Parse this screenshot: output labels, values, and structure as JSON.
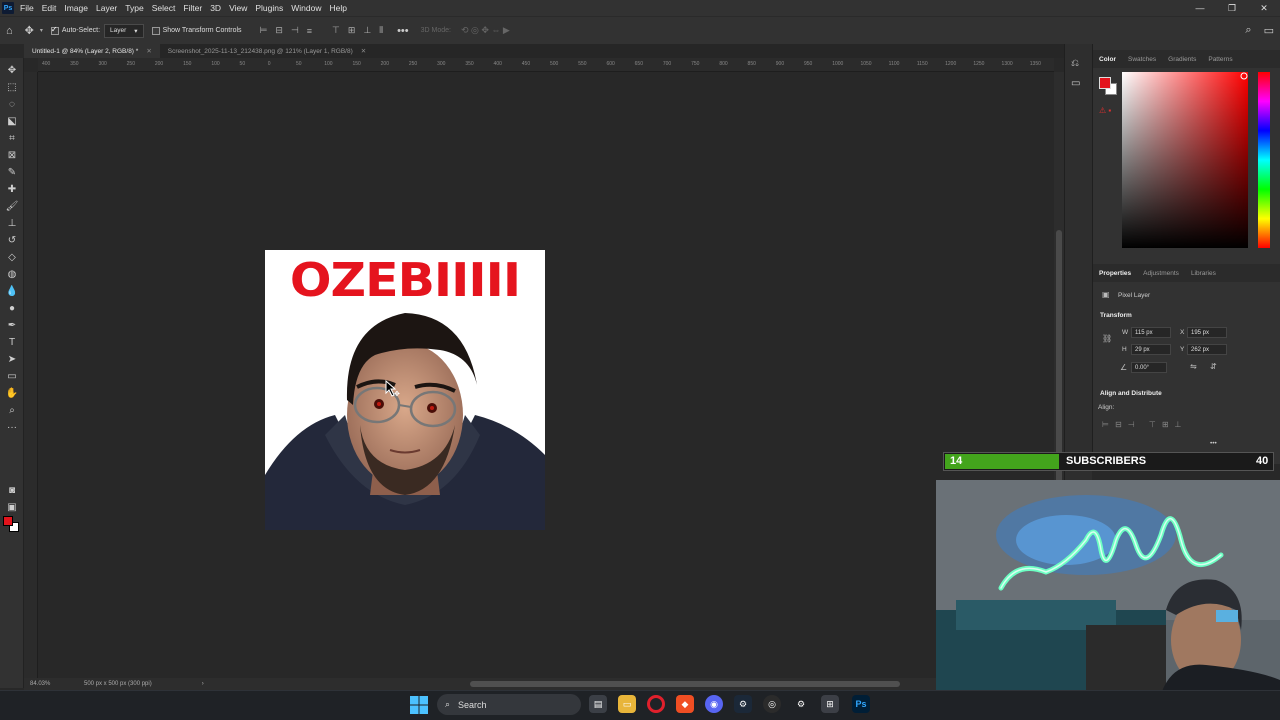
{
  "app": {
    "logo": "Ps",
    "menu": [
      "File",
      "Edit",
      "Image",
      "Layer",
      "Type",
      "Select",
      "Filter",
      "3D",
      "View",
      "Plugins",
      "Window",
      "Help"
    ],
    "window_controls": [
      "—",
      "❐",
      "✕"
    ]
  },
  "options_bar": {
    "auto_select_label": "Auto-Select:",
    "auto_select_checked": true,
    "layer_select": "Layer",
    "transform_label": "Show Transform Controls",
    "transform_checked": false,
    "mode_3d": "3D Mode:",
    "more": "•••"
  },
  "tabs": [
    {
      "label": "Untitled-1 @ 84% (Layer 2, RGB/8) *",
      "active": true
    },
    {
      "label": "Screenshot_2025-11-13_212438.png @ 121% (Layer 1, RGB/8)",
      "active": false
    }
  ],
  "ruler_labels": [
    "400",
    "350",
    "300",
    "250",
    "200",
    "150",
    "100",
    "50",
    "0",
    "50",
    "100",
    "150",
    "200",
    "250",
    "300",
    "350",
    "400",
    "450",
    "500",
    "550",
    "600",
    "650",
    "700",
    "750",
    "800",
    "850",
    "900",
    "950",
    "1000",
    "1050",
    "1100",
    "1150",
    "1200",
    "1250",
    "1300",
    "1350"
  ],
  "canvas": {
    "title_text": "OZEBIIIII",
    "title_color": "#e5141e"
  },
  "status": {
    "zoom": "84.03%",
    "doc_info": "500 px x 500 px (300 ppi)",
    "arrow": "›"
  },
  "color_panel": {
    "tabs": [
      "Color",
      "Swatches",
      "Gradients",
      "Patterns"
    ],
    "foreground": "#e3141c",
    "background": "#ffffff"
  },
  "properties_panel": {
    "tabs": [
      "Properties",
      "Adjustments",
      "Libraries"
    ],
    "layer_type": "Pixel Layer",
    "transform_heading": "Transform",
    "w_label": "W",
    "w_value": "115 px",
    "h_label": "H",
    "h_value": "29 px",
    "x_label": "X",
    "x_value": "195 px",
    "y_label": "Y",
    "y_value": "262 px",
    "angle_value": "0.00°",
    "align_heading": "Align and Distribute",
    "align_label": "Align:",
    "more": "•••"
  },
  "subscriber_goal": {
    "current": "14",
    "label": "SUBSCRIBERS",
    "goal": "40",
    "progress": 0.35,
    "fill_color": "#43a41c"
  },
  "taskbar": {
    "search_placeholder": "Search",
    "apps": [
      "file-explorer",
      "folder",
      "opera",
      "brave",
      "discord",
      "steam",
      "obs",
      "settings",
      "app",
      "photoshop"
    ]
  }
}
